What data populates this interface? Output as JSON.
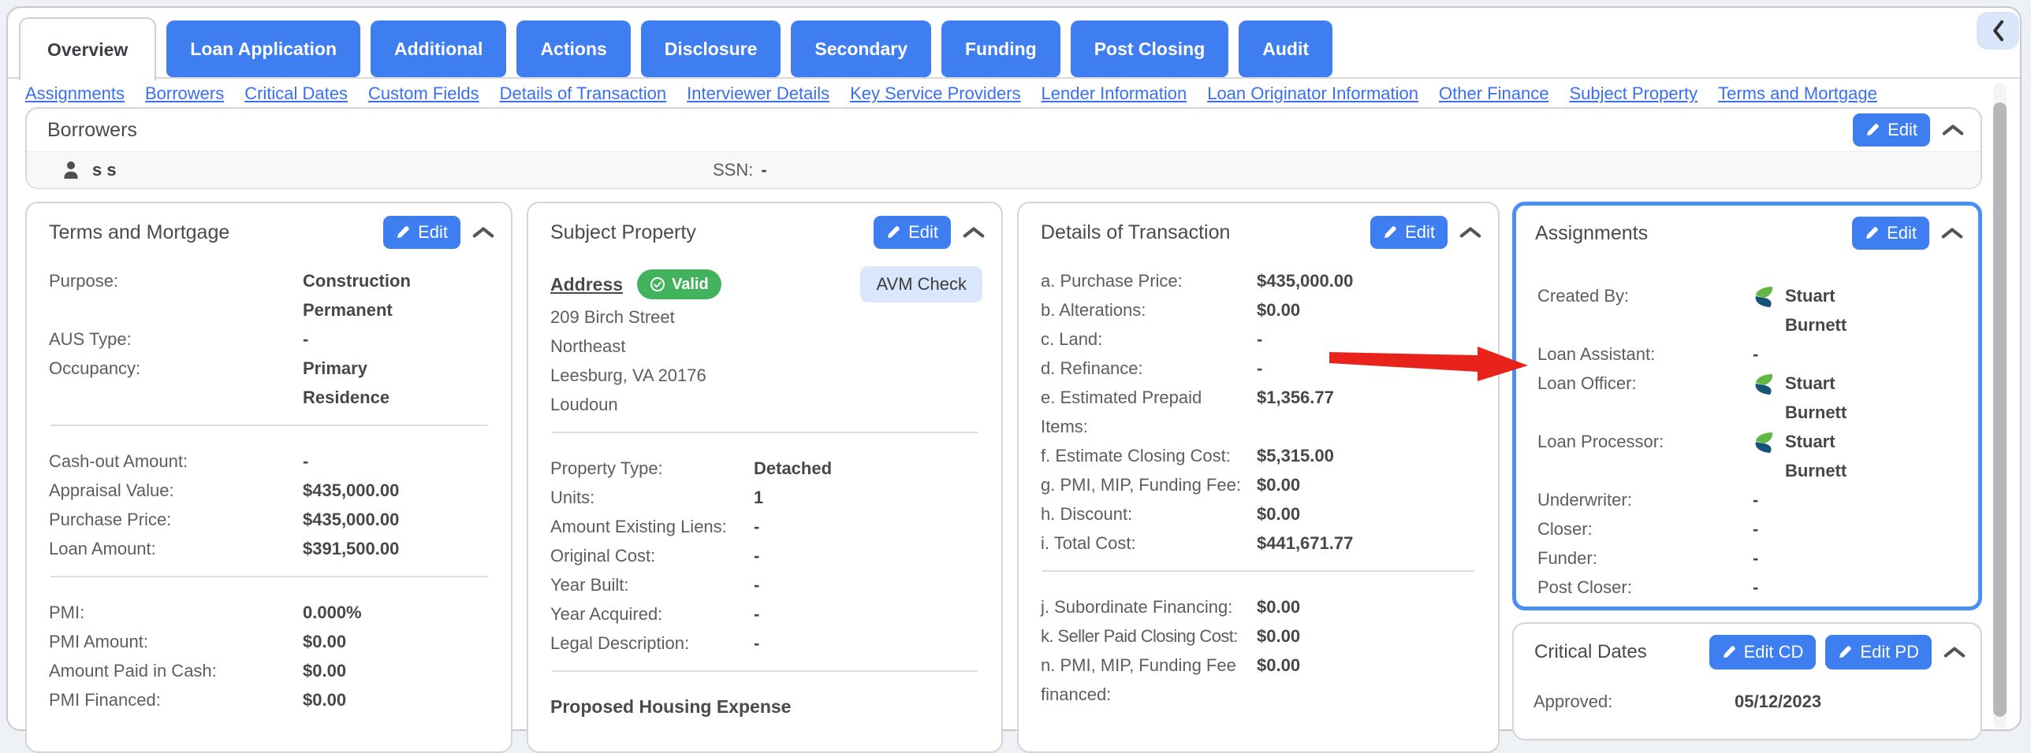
{
  "tabs": [
    {
      "label": "Overview",
      "active": true
    },
    {
      "label": "Loan Application",
      "active": false
    },
    {
      "label": "Additional",
      "active": false
    },
    {
      "label": "Actions",
      "active": false
    },
    {
      "label": "Disclosure",
      "active": false
    },
    {
      "label": "Secondary",
      "active": false
    },
    {
      "label": "Funding",
      "active": false
    },
    {
      "label": "Post Closing",
      "active": false
    },
    {
      "label": "Audit",
      "active": false
    }
  ],
  "nav_links": [
    "Assignments",
    "Borrowers",
    "Critical Dates",
    "Custom Fields",
    "Details of Transaction",
    "Interviewer Details",
    "Key Service Providers",
    "Lender Information",
    "Loan Originator Information",
    "Other Finance",
    "Subject Property",
    "Terms and Mortgage"
  ],
  "borrowers": {
    "title": "Borrowers",
    "edit_label": "Edit",
    "name": "s s",
    "ssn_label": "SSN:",
    "ssn_value": "-"
  },
  "terms_and_mortgage": {
    "title": "Terms and Mortgage",
    "edit_label": "Edit",
    "rows": [
      {
        "label": "Purpose:",
        "value": "Construction Permanent"
      },
      {
        "label": "AUS Type:",
        "value": "-"
      },
      {
        "label": "Occupancy:",
        "value": "Primary Residence"
      },
      {
        "label": "Cash-out Amount:",
        "value": "-"
      },
      {
        "label": "Appraisal Value:",
        "value": "$435,000.00"
      },
      {
        "label": "Purchase Price:",
        "value": "$435,000.00"
      },
      {
        "label": "Loan Amount:",
        "value": "$391,500.00"
      },
      {
        "label": "PMI:",
        "value": "0.000%"
      },
      {
        "label": "PMI Amount:",
        "value": "$0.00"
      },
      {
        "label": "Amount Paid in Cash:",
        "value": "$0.00"
      },
      {
        "label": "PMI Financed:",
        "value": "$0.00"
      }
    ]
  },
  "subject_property": {
    "title": "Subject Property",
    "edit_label": "Edit",
    "address_label": "Address",
    "valid_badge": "Valid",
    "avm_button": "AVM Check",
    "address_lines": [
      "209 Birch Street",
      "Northeast",
      "Leesburg, VA 20176",
      "Loudoun"
    ],
    "rows": [
      {
        "label": "Property Type:",
        "value": "Detached"
      },
      {
        "label": "Units:",
        "value": "1"
      },
      {
        "label": "Amount Existing Liens:",
        "value": "-"
      },
      {
        "label": "Original Cost:",
        "value": "-"
      },
      {
        "label": "Year Built:",
        "value": "-"
      },
      {
        "label": "Year Acquired:",
        "value": "-"
      },
      {
        "label": "Legal Description:",
        "value": "-"
      }
    ],
    "section_heading": "Proposed Housing Expense"
  },
  "details_of_transaction": {
    "title": "Details of Transaction",
    "edit_label": "Edit",
    "rows": [
      {
        "label": "a. Purchase Price:",
        "value": "$435,000.00"
      },
      {
        "label": "b. Alterations:",
        "value": "$0.00"
      },
      {
        "label": "c. Land:",
        "value": "-"
      },
      {
        "label": "d. Refinance:",
        "value": "-"
      },
      {
        "label": "e. Estimated Prepaid Items:",
        "value": "$1,356.77"
      },
      {
        "label": "f. Estimate Closing Cost:",
        "value": "$5,315.00"
      },
      {
        "label": "g. PMI, MIP, Funding Fee:",
        "value": "$0.00"
      },
      {
        "label": "h. Discount:",
        "value": "$0.00"
      },
      {
        "label": "i. Total Cost:",
        "value": "$441,671.77"
      },
      {
        "label": "j. Subordinate Financing:",
        "value": "$0.00"
      },
      {
        "label": "k. Seller Paid Closing Cost:",
        "value": "$0.00"
      },
      {
        "label": "n. PMI, MIP, Funding Fee financed:",
        "value": "$0.00"
      }
    ]
  },
  "assignments": {
    "title": "Assignments",
    "edit_label": "Edit",
    "rows": [
      {
        "label": "Created By:",
        "value": "Stuart Burnett",
        "has_icon": true
      },
      {
        "label": "Loan Assistant:",
        "value": "-",
        "has_icon": false
      },
      {
        "label": "Loan Officer:",
        "value": "Stuart Burnett",
        "has_icon": true
      },
      {
        "label": "Loan Processor:",
        "value": "Stuart Burnett",
        "has_icon": true
      },
      {
        "label": "Underwriter:",
        "value": "-",
        "has_icon": false
      },
      {
        "label": "Closer:",
        "value": "-",
        "has_icon": false
      },
      {
        "label": "Funder:",
        "value": "-",
        "has_icon": false
      },
      {
        "label": "Post Closer:",
        "value": "-",
        "has_icon": false
      }
    ]
  },
  "critical_dates": {
    "title": "Critical Dates",
    "edit_cd_label": "Edit CD",
    "edit_pd_label": "Edit PD",
    "rows": [
      {
        "label": "Approved:",
        "value": "05/12/2023"
      }
    ]
  },
  "colors": {
    "accent_blue": "#3e7ef0",
    "link_blue": "#3a6ff0",
    "valid_green": "#42b35c",
    "highlight_border": "#4a90f2",
    "annotation_red": "#e8231c"
  }
}
